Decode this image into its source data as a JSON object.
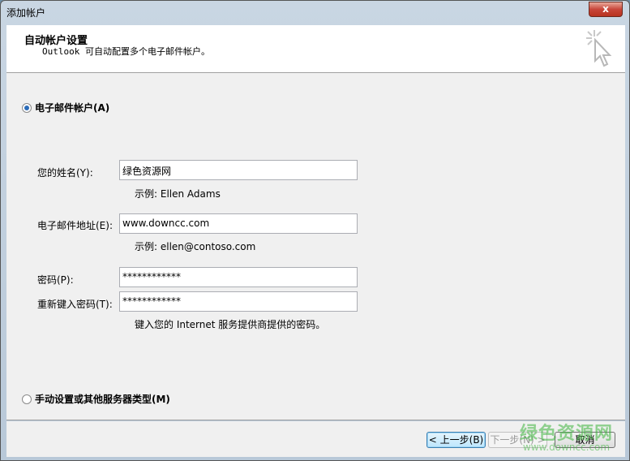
{
  "window": {
    "title": "添加帐户",
    "close_label": "x"
  },
  "header": {
    "title": "自动帐户设置",
    "subtitle": "Outlook 可自动配置多个电子邮件帐户。"
  },
  "options": {
    "email_account": "电子邮件帐户(A)",
    "manual": "手动设置或其他服务器类型(M)"
  },
  "form": {
    "name_label": "您的姓名(Y):",
    "name_value": "绿色资源网",
    "name_hint": "示例: Ellen Adams",
    "email_label": "电子邮件地址(E):",
    "email_value": "www.downcc.com",
    "email_hint": "示例: ellen@contoso.com",
    "password_label": "密码(P):",
    "password_value": "************",
    "retype_label": "重新键入密码(T):",
    "retype_value": "************",
    "password_hint": "键入您的 Internet 服务提供商提供的密码。"
  },
  "buttons": {
    "back": "< 上一步(B)",
    "next": "下一步(N) >",
    "cancel": "取消"
  },
  "watermark": {
    "text": "绿色资源网",
    "url": "www.downcc.com"
  }
}
